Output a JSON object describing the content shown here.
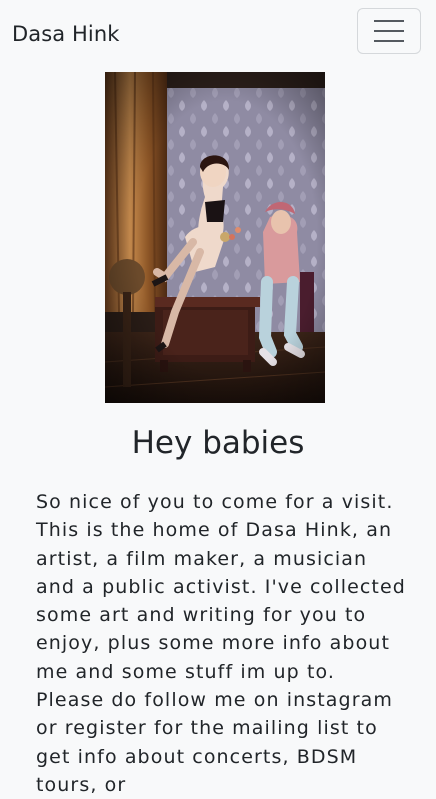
{
  "navbar": {
    "brand": "Dasa Hink",
    "toggle_icon": "hamburger-menu-icon"
  },
  "hero": {
    "image_alt": "Dasa Hink photo",
    "title": "Hey babies"
  },
  "intro": {
    "text": "So nice of you to come for a visit. This is the home of Dasa Hink, an artist, a film maker, a musician and a public activist. I've collected some art and writing for you to enjoy, plus some more info about me and some stuff im up to. Please do follow me on instagram or register for the mailing list to get info about concerts, BDSM tours, or"
  }
}
